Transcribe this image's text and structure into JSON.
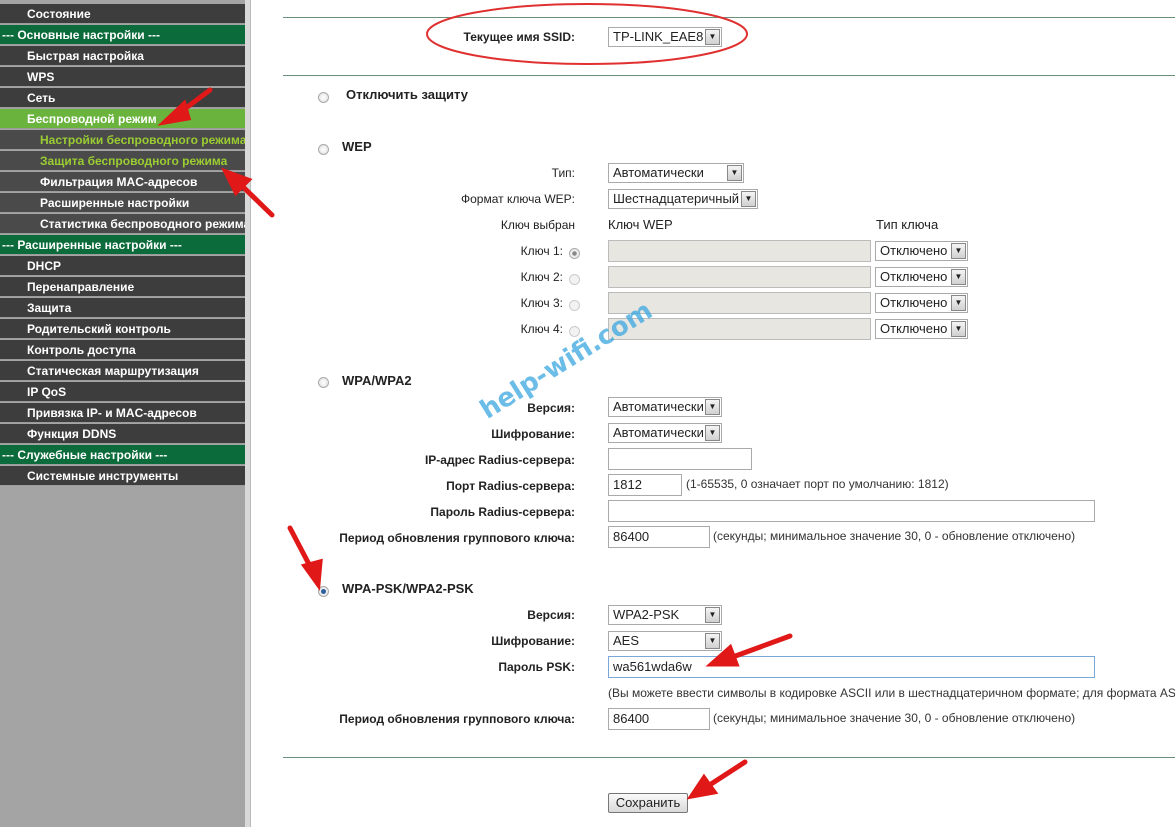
{
  "sidebar": {
    "items": [
      {
        "label": "Состояние",
        "level": "l1"
      },
      {
        "label": "--- Основные настройки ---",
        "level": "hd"
      },
      {
        "label": "Быстрая настройка",
        "level": "l1"
      },
      {
        "label": "WPS",
        "level": "l1"
      },
      {
        "label": "Сеть",
        "level": "l1"
      },
      {
        "label": "Беспроводной режим",
        "level": "l1",
        "active": true
      },
      {
        "label": "Настройки беспроводного режима",
        "level": "l2",
        "highlight": true
      },
      {
        "label": "Защита беспроводного режима",
        "level": "l2",
        "highlight": true
      },
      {
        "label": "Фильтрация MAC-адресов",
        "level": "l2"
      },
      {
        "label": "Расширенные настройки",
        "level": "l2"
      },
      {
        "label": "Статистика беспроводного режима",
        "level": "l2"
      },
      {
        "label": "--- Расширенные настройки ---",
        "level": "hd"
      },
      {
        "label": "DHCP",
        "level": "l1"
      },
      {
        "label": "Перенаправление",
        "level": "l1"
      },
      {
        "label": "Защита",
        "level": "l1"
      },
      {
        "label": "Родительский контроль",
        "level": "l1"
      },
      {
        "label": "Контроль доступа",
        "level": "l1"
      },
      {
        "label": "Статическая маршрутизация",
        "level": "l1"
      },
      {
        "label": "IP QoS",
        "level": "l1"
      },
      {
        "label": "Привязка IP- и MAC-адресов",
        "level": "l1"
      },
      {
        "label": "Функция DDNS",
        "level": "l1"
      },
      {
        "label": "--- Служебные настройки ---",
        "level": "hd"
      },
      {
        "label": "Системные инструменты",
        "level": "l1"
      }
    ]
  },
  "ssid": {
    "label": "Текущее имя SSID:",
    "value": "TP-LINK_EAE8"
  },
  "disable": {
    "label": "Отключить защиту"
  },
  "wep": {
    "title": "WEP",
    "type_label": "Тип:",
    "type_value": "Автоматически",
    "format_label": "Формат ключа WEP:",
    "format_value": "Шестнадцатеричный",
    "col_selected": "Ключ выбран",
    "col_key": "Ключ WEP",
    "col_type": "Тип ключа",
    "keys": [
      {
        "label": "Ключ 1:",
        "type": "Отключено"
      },
      {
        "label": "Ключ 2:",
        "type": "Отключено"
      },
      {
        "label": "Ключ 3:",
        "type": "Отключено"
      },
      {
        "label": "Ключ 4:",
        "type": "Отключено"
      }
    ]
  },
  "wpa": {
    "title": "WPA/WPA2",
    "version_label": "Версия:",
    "version_value": "Автоматически",
    "enc_label": "Шифрование:",
    "enc_value": "Автоматически",
    "radius_ip_label": "IP-адрес Radius-сервера:",
    "radius_port_label": "Порт Radius-сервера:",
    "radius_port_value": "1812",
    "radius_port_note": "(1-65535, 0 означает порт по умолчанию: 1812)",
    "radius_pass_label": "Пароль Radius-сервера:",
    "group_label": "Период обновления группового ключа:",
    "group_value": "86400",
    "group_note": "(секунды; минимальное значение 30, 0 - обновление отключено)"
  },
  "psk": {
    "title": "WPA-PSK/WPA2-PSK",
    "version_label": "Версия:",
    "version_value": "WPA2-PSK",
    "enc_label": "Шифрование:",
    "enc_value": "AES",
    "pass_label": "Пароль PSK:",
    "pass_value": "wa561wda6w",
    "pass_note": "(Вы можете ввести символы в кодировке ASCII или в шестнадцатеричном формате; для формата AS",
    "group_label": "Период обновления группового ключа:",
    "group_value": "86400",
    "group_note": "(секунды; минимальное значение 30, 0 - обновление отключено)"
  },
  "save_label": "Сохранить",
  "watermark": "help-wifi.com",
  "accent": "#0b6b3a",
  "active": "#6ab43e"
}
